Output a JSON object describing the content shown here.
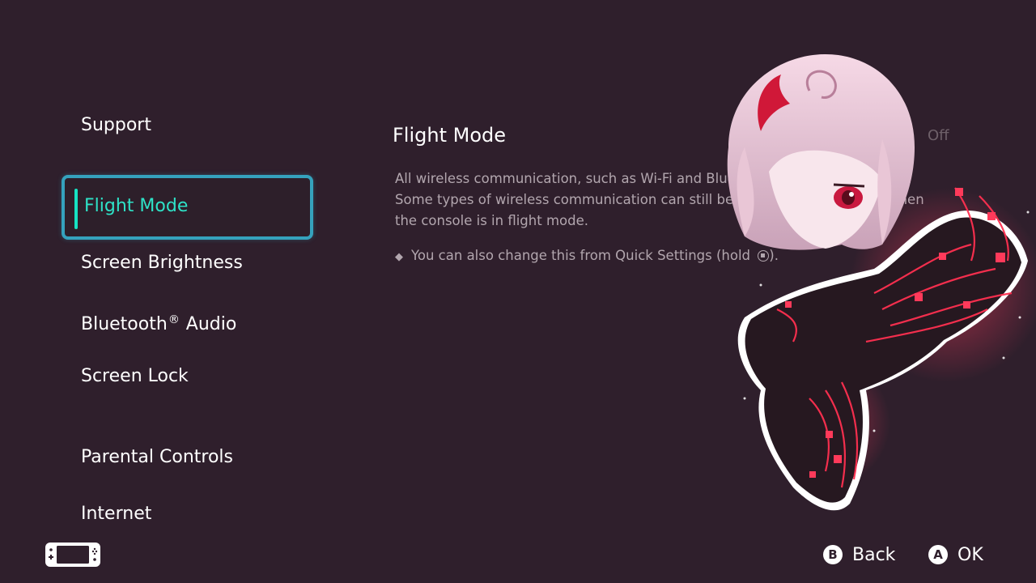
{
  "sidebar": {
    "items": [
      {
        "label": "Support"
      },
      {
        "label": "Flight Mode",
        "selected": true
      },
      {
        "label": "Screen Brightness"
      },
      {
        "label_main": "Bluetooth",
        "label_mark": "®",
        "label_end": " Audio"
      },
      {
        "label": "Screen Lock"
      },
      {
        "label": "Parental Controls"
      },
      {
        "label": "Internet"
      }
    ]
  },
  "content": {
    "title": "Flight Mode",
    "toggle_value": "Off",
    "description_lines": [
      "All wireless communication, such as Wi-Fi and Bluetooth, will be switched off.",
      "Some types of wireless communication can still be switched on manually when",
      "the console is in flight mode."
    ],
    "note": "You can also change this from Quick Settings (hold",
    "note_end": ")."
  },
  "footer": {
    "back_key": "B",
    "back_label": "Back",
    "ok_key": "A",
    "ok_label": "OK"
  },
  "colors": {
    "background": "#2f1f2c",
    "selection_border": "#35a2bd",
    "selection_text": "#2ee2c7",
    "description_text": "#b2a6ae"
  },
  "icons": {
    "console": "handheld-console-icon",
    "note_bullet": "diamond-icon",
    "home": "home-button-icon"
  }
}
